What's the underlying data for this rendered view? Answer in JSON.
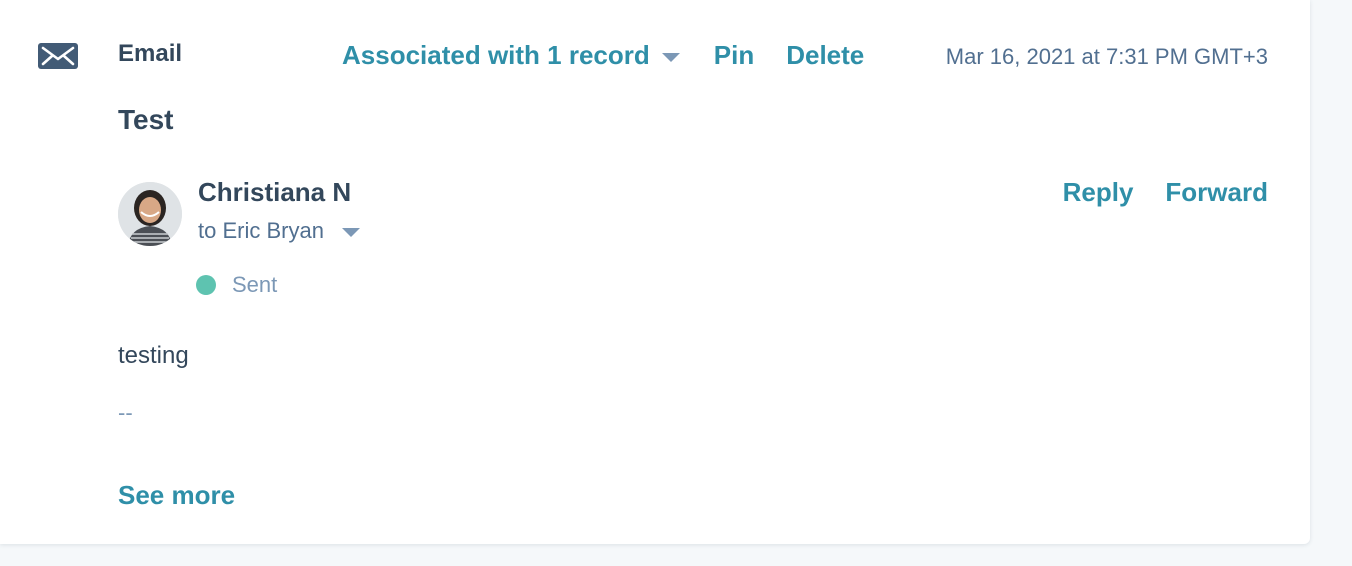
{
  "activity": {
    "type_label": "Email",
    "type_icon": "envelope-icon",
    "associated_label": "Associated with 1 record",
    "pin_label": "Pin",
    "delete_label": "Delete",
    "timestamp": "Mar 16, 2021 at 7:31 PM GMT+3"
  },
  "email": {
    "subject": "Test",
    "sender_name": "Christiana N",
    "recipient_line": "to Eric Bryan",
    "status_label": "Sent",
    "status_color": "#5ec3b0",
    "reply_label": "Reply",
    "forward_label": "Forward",
    "body": "testing",
    "signature": "--",
    "see_more_label": "See more"
  },
  "colors": {
    "link": "#2f8fa8",
    "text_primary": "#33475b",
    "text_secondary": "#516f90",
    "icon": "#425b76"
  }
}
